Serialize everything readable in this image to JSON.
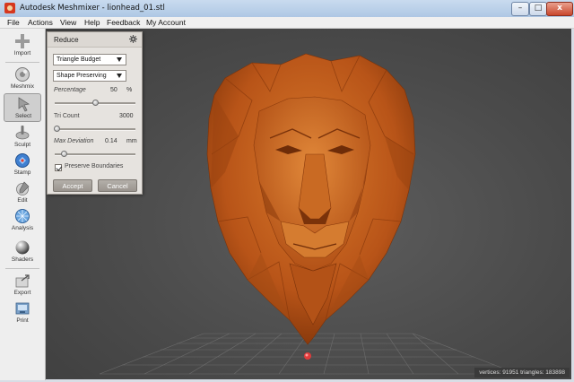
{
  "window": {
    "title": "Autodesk Meshmixer - lionhead_01.stl",
    "minimize_label": "–",
    "maximize_label": "□",
    "close_label": "x"
  },
  "menu": [
    "File",
    "Actions",
    "View",
    "Help",
    "Feedback",
    "My Account"
  ],
  "toolbar": {
    "items": [
      {
        "label": "Import",
        "icon": "plus-icon"
      },
      {
        "label": "Meshmix",
        "icon": "meshmix-icon"
      },
      {
        "label": "Select",
        "icon": "select-arrow-icon",
        "active": true
      },
      {
        "label": "Sculpt",
        "icon": "sculpt-brush-icon"
      },
      {
        "label": "Stamp",
        "icon": "stamp-icon"
      },
      {
        "label": "Edit",
        "icon": "edit-icon"
      },
      {
        "label": "Analysis",
        "icon": "analysis-icon"
      },
      {
        "label": "Shaders",
        "icon": "shaders-sphere-icon"
      },
      {
        "label": "Export",
        "icon": "export-icon"
      },
      {
        "label": "Print",
        "icon": "print-icon"
      }
    ]
  },
  "reduce_panel": {
    "title": "Reduce",
    "reduce_mode": "Triangle Budget",
    "reduce_type": "Shape Preserving",
    "percentage_label": "Percentage",
    "percentage_value": "50",
    "percentage_unit": "%",
    "percentage_slider": 0.5,
    "tri_count_label": "Tri Count",
    "tri_count_value": "3000",
    "tri_count_slider": 0.03,
    "max_deviation_label": "Max Deviation",
    "max_deviation_value": "0.14",
    "max_deviation_unit": "mm",
    "max_deviation_slider": 0.12,
    "preserve_boundaries_label": "Preserve Boundaries",
    "preserve_boundaries_checked": true,
    "accept_label": "Accept",
    "cancel_label": "Cancel"
  },
  "status": {
    "text": "vertices: 91951 triangles: 183898"
  },
  "colors": {
    "model_orange": "#c4621e",
    "viewport_bg": "#4b4b4b",
    "pivot_red": "#e23b3b"
  }
}
